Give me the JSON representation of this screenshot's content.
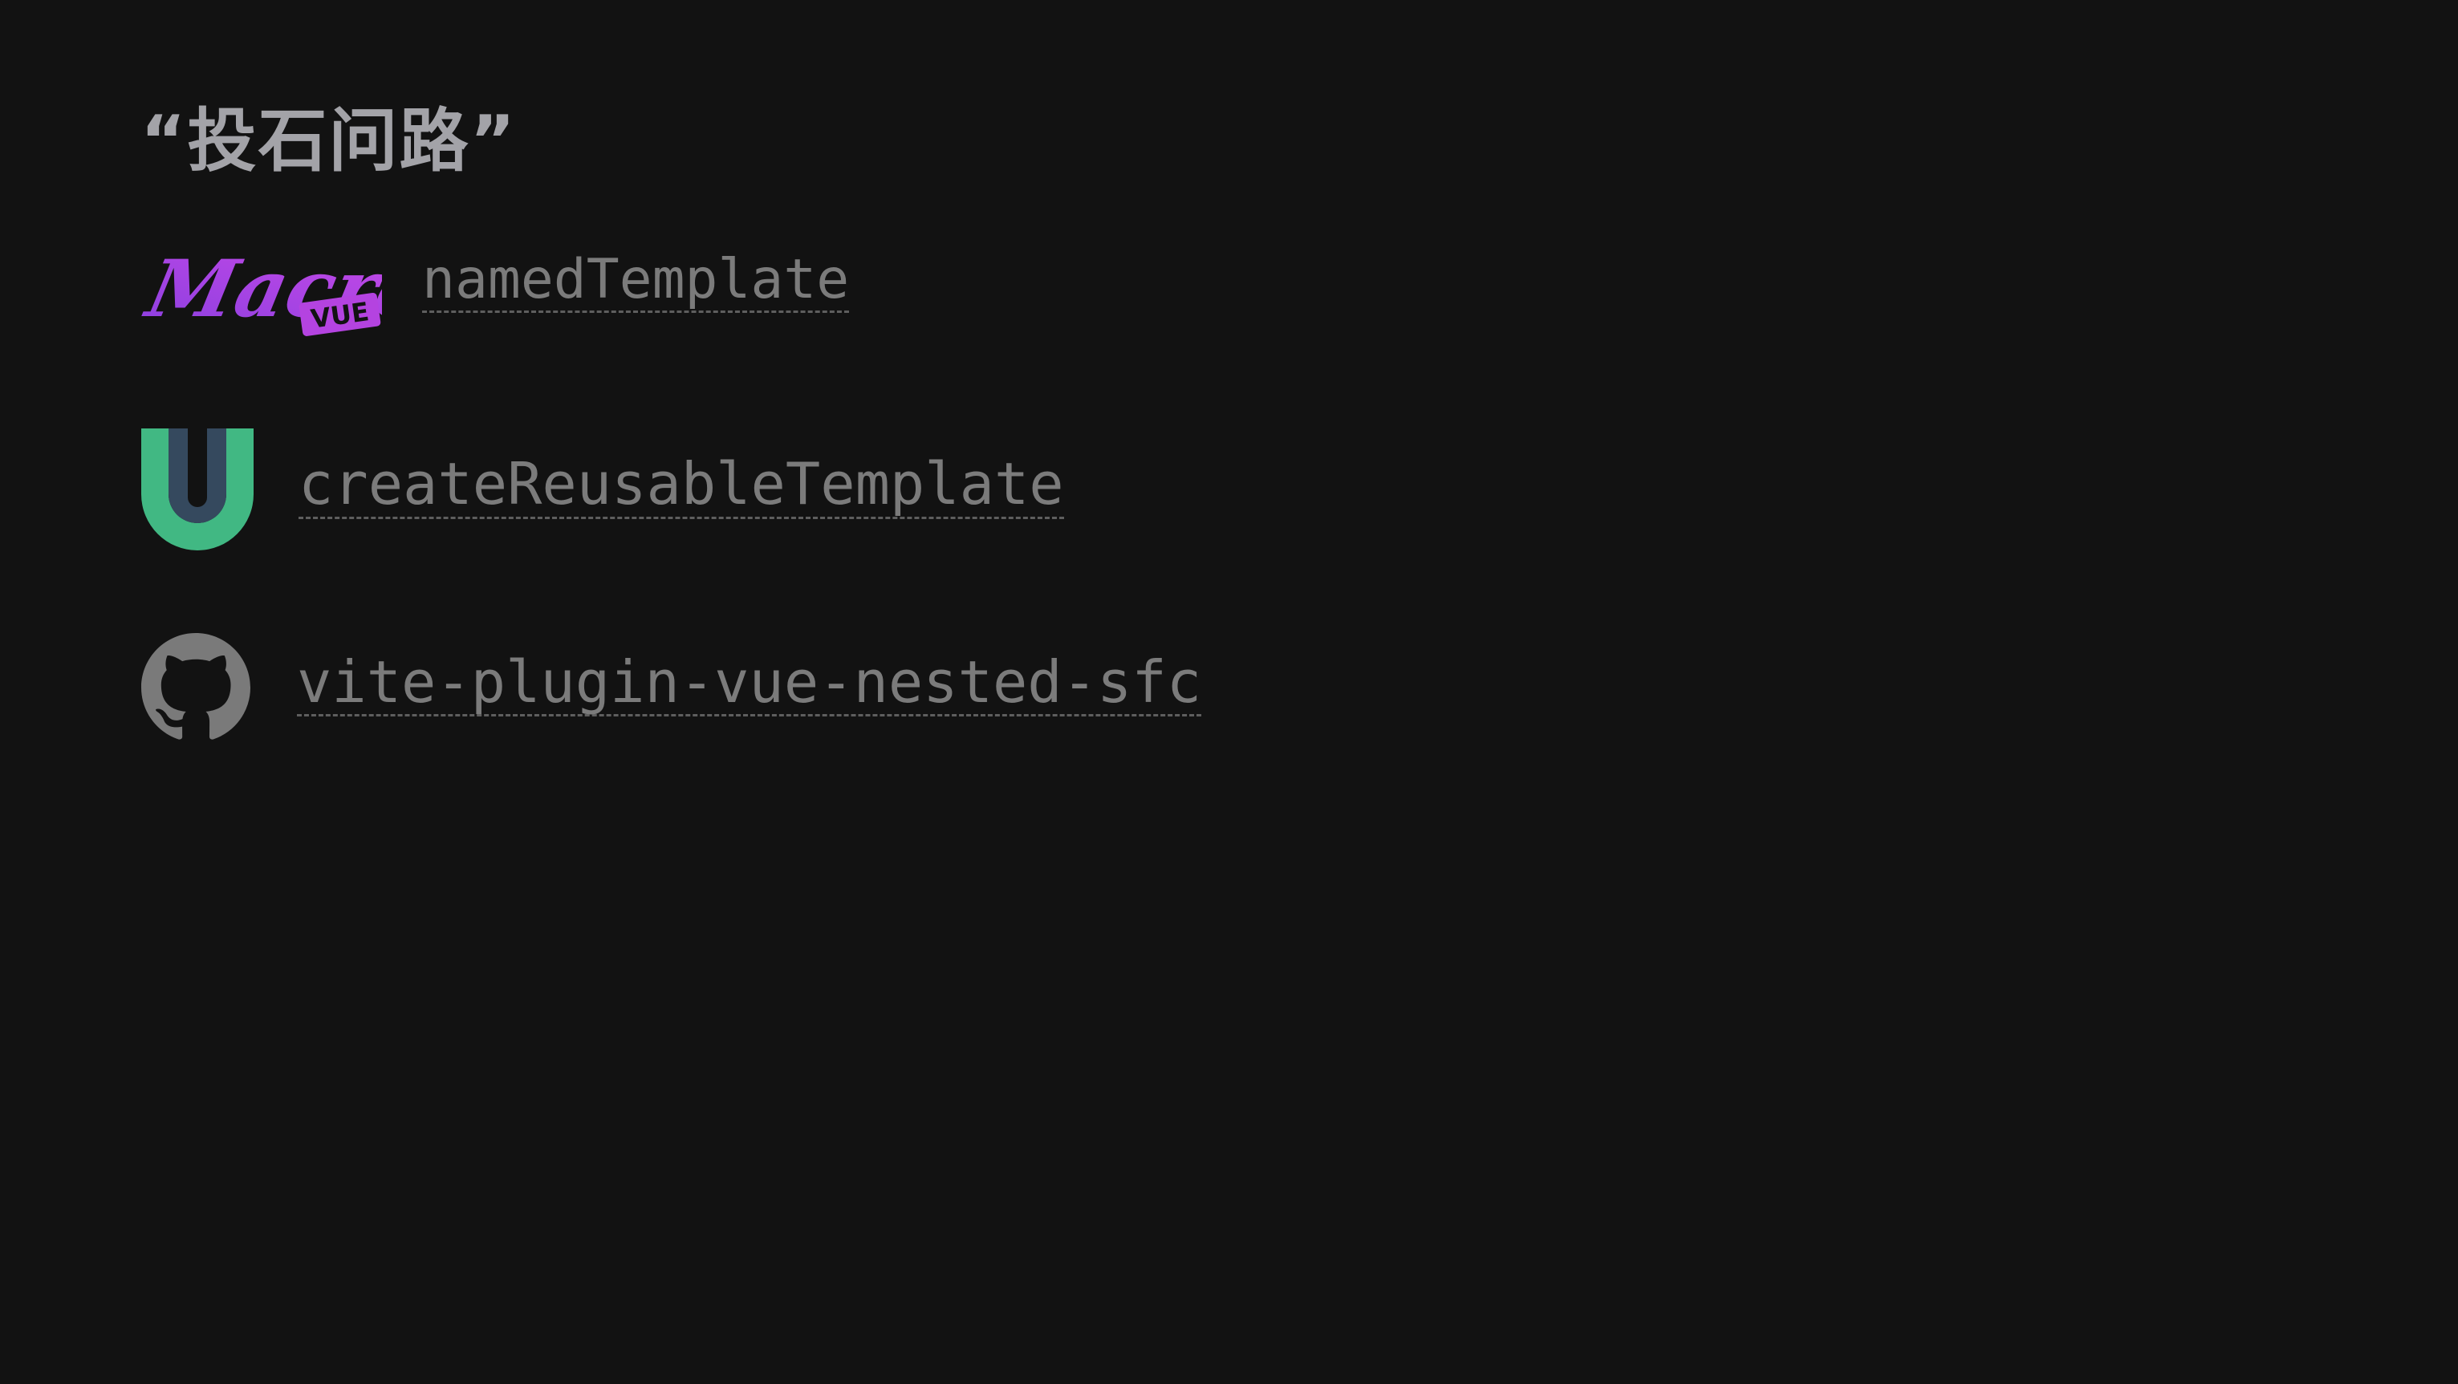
{
  "slide": {
    "title": "“投石问路”",
    "items": [
      {
        "icon": "vue-macros-logo",
        "logo_text": "Macros",
        "logo_badge": "VUE",
        "label": "namedTemplate"
      },
      {
        "icon": "vueuse-logo",
        "label": "createReusableTemplate"
      },
      {
        "icon": "github-icon",
        "label": "vite-plugin-vue-nested-sfc"
      }
    ]
  },
  "colors": {
    "background": "#121212",
    "title": "#a3a3a8",
    "link_text": "#7b7b7b",
    "link_underline": "#5e5e5e",
    "macros_purple": "#b443e0",
    "vueuse_green": "#41b883",
    "vueuse_dark": "#35495e",
    "github_gray": "#7a7a7a"
  }
}
